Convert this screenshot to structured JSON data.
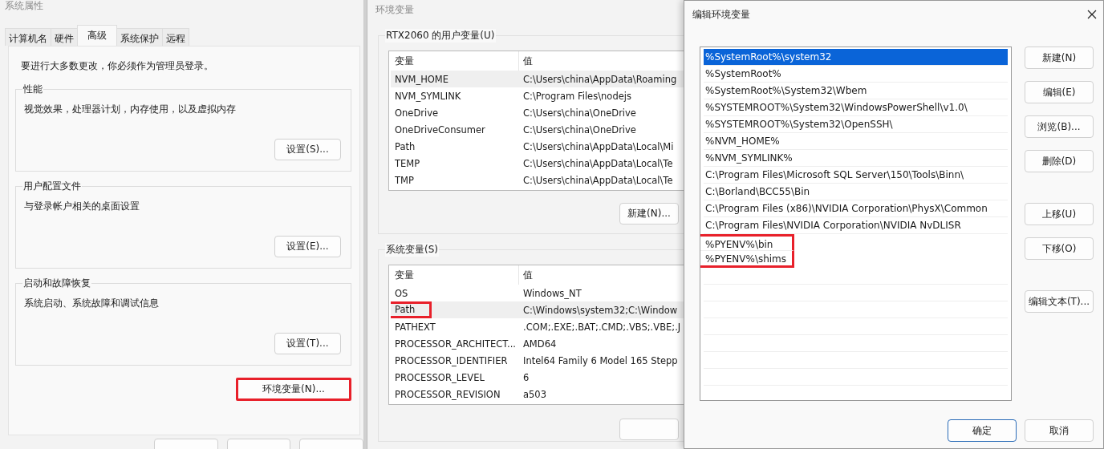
{
  "system_properties": {
    "title": "系统属性",
    "tabs": [
      {
        "label": "计算机名",
        "selected": false
      },
      {
        "label": "硬件",
        "selected": false
      },
      {
        "label": "高级",
        "selected": true
      },
      {
        "label": "系统保护",
        "selected": false
      },
      {
        "label": "远程",
        "selected": false
      }
    ],
    "notice": "要进行大多数更改，你必须作为管理员登录。",
    "groups": [
      {
        "title": "性能",
        "description": "视觉效果，处理器计划，内存使用，以及虚拟内存",
        "button": "设置(S)..."
      },
      {
        "title": "用户配置文件",
        "description": "与登录帐户相关的桌面设置",
        "button": "设置(E)..."
      },
      {
        "title": "启动和故障恢复",
        "description": "系统启动、系统故障和调试信息",
        "button": "设置(T)..."
      }
    ],
    "env_button": {
      "label": "环境变量(N)...",
      "highlighted": true
    }
  },
  "environment_variables": {
    "title": "环境变量",
    "sections": [
      {
        "title": "RTX2060 的用户变量(U)",
        "columns": [
          "变量",
          "值"
        ],
        "button": "新建(N)...",
        "rows": [
          {
            "name": "NVM_HOME",
            "value": "C:\\Users\\china\\AppData\\Roaming",
            "selected": true,
            "highlighted": false
          },
          {
            "name": "NVM_SYMLINK",
            "value": "C:\\Program Files\\nodejs",
            "selected": false,
            "highlighted": false
          },
          {
            "name": "OneDrive",
            "value": "C:\\Users\\china\\OneDrive",
            "selected": false,
            "highlighted": false
          },
          {
            "name": "OneDriveConsumer",
            "value": "C:\\Users\\china\\OneDrive",
            "selected": false,
            "highlighted": false
          },
          {
            "name": "Path",
            "value": "C:\\Users\\china\\AppData\\Local\\Mi",
            "selected": false,
            "highlighted": false
          },
          {
            "name": "TEMP",
            "value": "C:\\Users\\china\\AppData\\Local\\Te",
            "selected": false,
            "highlighted": false
          },
          {
            "name": "TMP",
            "value": "C:\\Users\\china\\AppData\\Local\\Te",
            "selected": false,
            "highlighted": false
          }
        ]
      },
      {
        "title": "系统变量(S)",
        "columns": [
          "变量",
          "值"
        ],
        "rows": [
          {
            "name": "OS",
            "value": "Windows_NT",
            "selected": false,
            "highlighted": false
          },
          {
            "name": "Path",
            "value": "C:\\Windows\\system32;C:\\Window",
            "selected": true,
            "highlighted": true
          },
          {
            "name": "PATHEXT",
            "value": ".COM;.EXE;.BAT;.CMD;.VBS;.VBE;.J",
            "selected": false,
            "highlighted": false
          },
          {
            "name": "PROCESSOR_ARCHITECT...",
            "value": "AMD64",
            "selected": false,
            "highlighted": false
          },
          {
            "name": "PROCESSOR_IDENTIFIER",
            "value": "Intel64 Family 6 Model 165 Stepp",
            "selected": false,
            "highlighted": false
          },
          {
            "name": "PROCESSOR_LEVEL",
            "value": "6",
            "selected": false,
            "highlighted": false
          },
          {
            "name": "PROCESSOR_REVISION",
            "value": "a503",
            "selected": false,
            "highlighted": false
          }
        ]
      }
    ]
  },
  "edit_environment_variable": {
    "title": "编辑环境变量",
    "entries": [
      {
        "text": "%SystemRoot%\\system32",
        "selected": true,
        "highlighted": false
      },
      {
        "text": "%SystemRoot%",
        "selected": false,
        "highlighted": false
      },
      {
        "text": "%SystemRoot%\\System32\\Wbem",
        "selected": false,
        "highlighted": false
      },
      {
        "text": "%SYSTEMROOT%\\System32\\WindowsPowerShell\\v1.0\\",
        "selected": false,
        "highlighted": false
      },
      {
        "text": "%SYSTEMROOT%\\System32\\OpenSSH\\",
        "selected": false,
        "highlighted": false
      },
      {
        "text": "%NVM_HOME%",
        "selected": false,
        "highlighted": false
      },
      {
        "text": "%NVM_SYMLINK%",
        "selected": false,
        "highlighted": false
      },
      {
        "text": "C:\\Program Files\\Microsoft SQL Server\\150\\Tools\\Binn\\",
        "selected": false,
        "highlighted": false
      },
      {
        "text": "C:\\Borland\\BCC55\\Bin",
        "selected": false,
        "highlighted": false
      },
      {
        "text": "C:\\Program Files (x86)\\NVIDIA Corporation\\PhysX\\Common",
        "selected": false,
        "highlighted": false
      },
      {
        "text": "C:\\Program Files\\NVIDIA Corporation\\NVIDIA NvDLISR",
        "selected": false,
        "highlighted": false
      },
      {
        "text": "%PYENV%\\bin",
        "selected": false,
        "highlighted": true
      },
      {
        "text": "%PYENV%\\shims",
        "selected": false,
        "highlighted": true
      }
    ],
    "button_groups": [
      [
        "新建(N)",
        "编辑(E)",
        "浏览(B)...",
        "删除(D)"
      ],
      [
        "上移(U)",
        "下移(O)"
      ],
      [
        "编辑文本(T)..."
      ]
    ],
    "ok_button": "确定",
    "cancel_button": "取消"
  }
}
